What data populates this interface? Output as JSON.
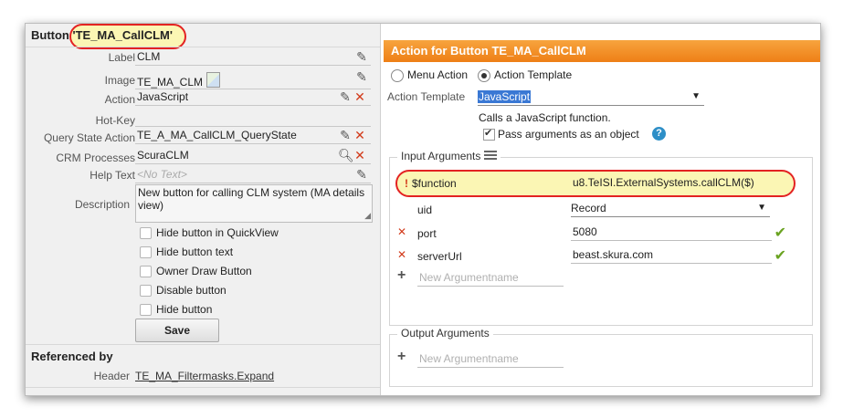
{
  "left": {
    "title_prefix": "Button",
    "title_name": "'TE_MA_CallCLM'",
    "fields": {
      "label": {
        "label": "Label",
        "value": "CLM"
      },
      "image": {
        "label": "Image",
        "value": "TE_MA_CLM"
      },
      "action": {
        "label": "Action",
        "value": "JavaScript"
      },
      "hotkey": {
        "label": "Hot-Key",
        "value": ""
      },
      "query_state": {
        "label": "Query State Action",
        "value": "TE_A_MA_CallCLM_QueryState"
      },
      "crm": {
        "label": "CRM Processes",
        "value": "ScuraCLM"
      },
      "helptext": {
        "label": "Help Text",
        "value": "<No Text>"
      },
      "description": {
        "label": "Description",
        "value": "New button for calling CLM system (MA details view)"
      }
    },
    "checkboxes": [
      {
        "label": "Hide button in QuickView"
      },
      {
        "label": "Hide button text"
      },
      {
        "label": "Owner Draw Button"
      },
      {
        "label": "Disable button"
      },
      {
        "label": "Hide button"
      }
    ],
    "save_label": "Save",
    "referenced_by": "Referenced by",
    "ref_header_label": "Header",
    "ref_header_link": "TE_MA_Filtermasks.Expand"
  },
  "right": {
    "header": "Action for Button TE_MA_CallCLM",
    "radio_menu": "Menu Action",
    "radio_template": "Action Template",
    "template_label": "Action Template",
    "template_value": "JavaScript",
    "template_desc": "Calls a JavaScript function.",
    "pass_args_label": "Pass arguments as an object",
    "input_legend": "Input Arguments",
    "args": [
      {
        "name": "$function",
        "value": "u8.TeISI.ExternalSystems.callCLM($)"
      },
      {
        "name": "uid",
        "value": "Record"
      },
      {
        "name": "port",
        "value": "5080"
      },
      {
        "name": "serverUrl",
        "value": "beast.skura.com"
      }
    ],
    "new_arg_placeholder": "New Argumentname",
    "output_legend": "Output Arguments",
    "new_out_placeholder": "New Argumentname"
  },
  "colors": {
    "header_orange": "#ee7f16",
    "highlight_red": "#e32222",
    "highlight_fill": "#fbf6b4",
    "check_green": "#6aa321",
    "delete_red": "#d23a1a"
  }
}
